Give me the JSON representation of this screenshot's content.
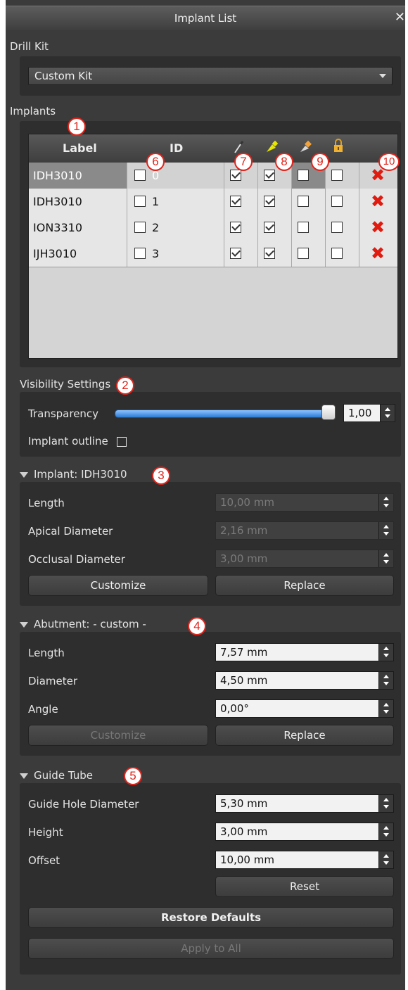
{
  "window": {
    "title": "Implant List",
    "close": "✕"
  },
  "drill_kit": {
    "label": "Drill Kit",
    "value": "Custom Kit"
  },
  "implants": {
    "label": "Implants",
    "columns": {
      "label": "Label",
      "id": "ID"
    },
    "rows": [
      {
        "label": "IDH3010",
        "id": "0",
        "selected": true,
        "c7": true,
        "c8": true,
        "c9": false,
        "lock": false
      },
      {
        "label": "IDH3010",
        "id": "1",
        "selected": false,
        "c7": true,
        "c8": true,
        "c9": false,
        "lock": false
      },
      {
        "label": "ION3310",
        "id": "2",
        "selected": false,
        "c7": true,
        "c8": true,
        "c9": false,
        "lock": false
      },
      {
        "label": "IJH3010",
        "id": "3",
        "selected": false,
        "c7": true,
        "c8": true,
        "c9": false,
        "lock": false
      }
    ],
    "delete_glyph": "✖"
  },
  "visibility": {
    "label": "Visibility Settings",
    "transparency_label": "Transparency",
    "transparency_value": "1,00",
    "transparency_fraction": 1.0,
    "outline_label": "Implant outline"
  },
  "implant_section": {
    "title": "Implant: IDH3010",
    "length_label": "Length",
    "length_value": "10,00 mm",
    "apical_label": "Apical Diameter",
    "apical_value": "2,16 mm",
    "occlusal_label": "Occlusal Diameter",
    "occlusal_value": "3,00 mm",
    "customize": "Customize",
    "replace": "Replace"
  },
  "abutment_section": {
    "title": "Abutment: - custom -",
    "length_label": "Length",
    "length_value": "7,57 mm",
    "diameter_label": "Diameter",
    "diameter_value": "4,50 mm",
    "angle_label": "Angle",
    "angle_value": "0,00°",
    "customize": "Customize",
    "replace": "Replace"
  },
  "guide_tube": {
    "title": "Guide Tube",
    "hole_label": "Guide Hole Diameter",
    "hole_value": "5,30 mm",
    "height_label": "Height",
    "height_value": "3,00 mm",
    "offset_label": "Offset",
    "offset_value": "10,00 mm",
    "reset": "Reset",
    "restore": "Restore Defaults",
    "apply": "Apply to All"
  },
  "markers": [
    "1",
    "2",
    "3",
    "4",
    "5",
    "6",
    "7",
    "8",
    "9",
    "10"
  ],
  "colors": {
    "marker_red": "#e0241b",
    "delete_red": "#e01b10",
    "slider_blue": "#2c7bd4"
  }
}
